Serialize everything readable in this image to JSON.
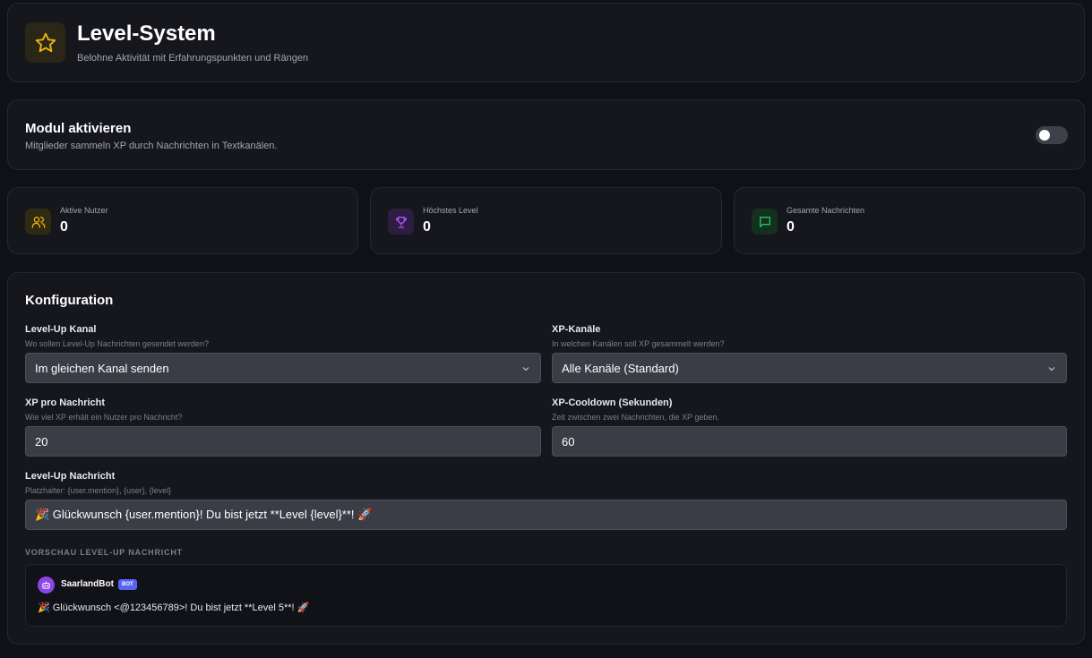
{
  "header": {
    "title": "Level-System",
    "subtitle": "Belohne Aktivität mit Erfahrungspunkten und Rängen",
    "icon": "star-icon",
    "accent": "#eab308"
  },
  "module": {
    "title": "Modul aktivieren",
    "description": "Mitglieder sammeln XP durch Nachrichten in Textkanälen.",
    "enabled": false
  },
  "stats": [
    {
      "label": "Aktive Nutzer",
      "value": "0",
      "icon": "users-icon",
      "color": "#eab308"
    },
    {
      "label": "Höchstes Level",
      "value": "0",
      "icon": "trophy-icon",
      "color": "#a855f7"
    },
    {
      "label": "Gesamte Nachrichten",
      "value": "0",
      "icon": "message-icon",
      "color": "#22c55e"
    }
  ],
  "config": {
    "title": "Konfiguration",
    "levelup_channel": {
      "label": "Level-Up Kanal",
      "help": "Wo sollen Level-Up Nachrichten gesendet werden?",
      "value": "Im gleichen Kanal senden"
    },
    "xp_channels": {
      "label": "XP-Kanäle",
      "help": "In welchen Kanälen soll XP gesammelt werden?",
      "value": "Alle Kanäle (Standard)"
    },
    "xp_per_message": {
      "label": "XP pro Nachricht",
      "help": "Wie viel XP erhält ein Nutzer pro Nachricht?",
      "value": "20"
    },
    "xp_cooldown": {
      "label": "XP-Cooldown (Sekunden)",
      "help": "Zeit zwischen zwei Nachrichten, die XP geben.",
      "value": "60"
    },
    "levelup_message": {
      "label": "Level-Up Nachricht",
      "help": "Platzhalter: {user.mention}, {user}, {level}",
      "value": "🎉 Glückwunsch {user.mention}! Du bist jetzt **Level {level}**! 🚀"
    },
    "preview": {
      "label": "VORSCHAU LEVEL-UP NACHRICHT",
      "bot_name": "SaarlandBot",
      "bot_badge": "BOT",
      "message": "🎉 Glückwunsch <@123456789>! Du bist jetzt **Level 5**! 🚀"
    }
  }
}
